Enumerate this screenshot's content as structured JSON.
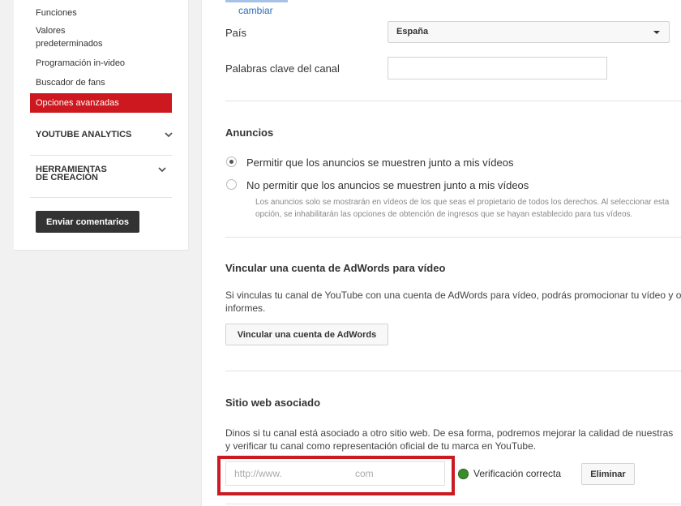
{
  "sidebar": {
    "items": [
      "Funciones",
      "Valores predeterminados",
      "Programación in-video",
      "Buscador de fans"
    ],
    "active_item": "Opciones avanzadas",
    "sections": [
      "YOUTUBE ANALYTICS",
      "HERRAMIENTAS DE CREACIÓN"
    ],
    "feedback_button": "Enviar comentarios"
  },
  "main": {
    "change_link": "cambiar",
    "country": {
      "label": "País",
      "value": "España"
    },
    "keywords": {
      "label": "Palabras clave del canal",
      "value": ""
    },
    "ads": {
      "heading": "Anuncios",
      "option_allow": "Permitir que los anuncios se muestren junto a mis vídeos",
      "option_disallow": "No permitir que los anuncios se muestren junto a mis vídeos",
      "selected": "allow",
      "note_line1": "Los anuncios solo se mostrarán en vídeos de los que seas el propietario de todos los derechos. Al seleccionar esta",
      "note_line2": "opción, se inhabilitarán las opciones de obtención de ingresos que se hayan establecido para tus vídeos."
    },
    "adwords": {
      "heading": "Vincular una cuenta de AdWords para vídeo",
      "text_line1": "Si vinculas tu canal de YouTube con una cuenta de AdWords para vídeo, podrás promocionar tu vídeo y obtener",
      "text_line2": "informes.",
      "button": "Vincular una cuenta de AdWords"
    },
    "website": {
      "heading": "Sitio web asociado",
      "text_line1": "Dinos si tu canal está asociado a otro sitio web. De esa forma, podremos mejorar la calidad de nuestras",
      "text_line2": "y verificar tu canal como representación oficial de tu marca en YouTube.",
      "url_prefix": "http://www.",
      "url_suffix": "com",
      "status": "Verificación correcta",
      "remove_button": "Eliminar"
    }
  },
  "colors": {
    "accent_red": "#cc181e",
    "link_blue": "#2b6cba",
    "status_green": "#3a8a2e"
  }
}
